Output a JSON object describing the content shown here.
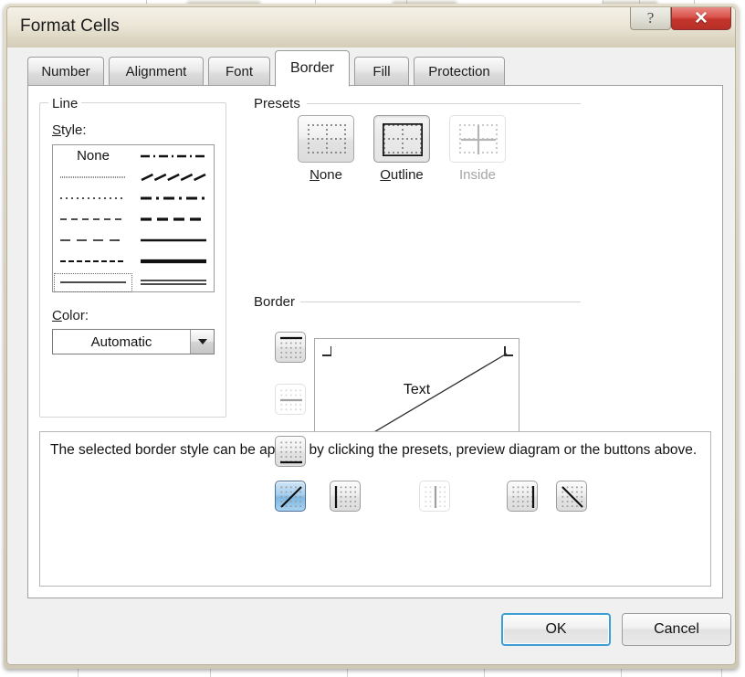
{
  "window": {
    "title": "Format Cells",
    "help_button": "?",
    "close_button": "✕"
  },
  "tabs": [
    {
      "label": "Number",
      "active": false
    },
    {
      "label": "Alignment",
      "active": false
    },
    {
      "label": "Font",
      "active": false
    },
    {
      "label": "Border",
      "active": true
    },
    {
      "label": "Fill",
      "active": false
    },
    {
      "label": "Protection",
      "active": false
    }
  ],
  "line_group": {
    "legend": "Line",
    "style_label": "Style:",
    "none_label": "None",
    "styles_left": [
      {
        "name": "none",
        "pattern": "none"
      },
      {
        "name": "hairline-dotted",
        "pattern": "fine-dotted"
      },
      {
        "name": "dotted",
        "pattern": "dotted"
      },
      {
        "name": "dashed-medium",
        "pattern": "dashed-medium"
      },
      {
        "name": "dash-long",
        "pattern": "dash-long"
      },
      {
        "name": "dashed-small",
        "pattern": "dashed-small"
      },
      {
        "name": "thin-solid",
        "pattern": "thin-solid",
        "selected": true
      }
    ],
    "styles_right": [
      {
        "name": "dash-dot",
        "pattern": "dash-dot"
      },
      {
        "name": "slanted-dash",
        "pattern": "slant-dash"
      },
      {
        "name": "dash-dot-heavy",
        "pattern": "dash-dot-heavy"
      },
      {
        "name": "dashed-heavy",
        "pattern": "dashed-heavy"
      },
      {
        "name": "solid-medium",
        "pattern": "solid-medium"
      },
      {
        "name": "solid-thick",
        "pattern": "solid-thick"
      },
      {
        "name": "double",
        "pattern": "double"
      }
    ],
    "color_label": "Color:",
    "color_value": "Automatic"
  },
  "presets": {
    "legend": "Presets",
    "items": [
      {
        "label": "None",
        "accel": "N",
        "state": "normal",
        "icon": "preset-none-icon"
      },
      {
        "label": "Outline",
        "accel": "O",
        "state": "pressed",
        "icon": "preset-outline-icon"
      },
      {
        "label": "Inside",
        "accel": "",
        "state": "disabled",
        "icon": "preset-inside-icon"
      }
    ]
  },
  "border": {
    "legend": "Border",
    "preview_text": "Text",
    "left_buttons": [
      {
        "name": "border-top-button",
        "state": "normal"
      },
      {
        "name": "border-horizontal-button",
        "state": "disabled"
      },
      {
        "name": "border-bottom-button",
        "state": "normal"
      }
    ],
    "bottom_buttons": [
      {
        "name": "border-diagonal-up-button",
        "state": "selected"
      },
      {
        "name": "border-left-button",
        "state": "normal"
      },
      {
        "name": "border-vertical-button",
        "state": "disabled"
      },
      {
        "name": "border-right-button",
        "state": "normal"
      },
      {
        "name": "border-diagonal-down-button",
        "state": "normal"
      }
    ],
    "highlight_color": "#e60000"
  },
  "description": "The selected border style can be applied by clicking the presets, preview diagram or the buttons above.",
  "footer": {
    "ok_label": "OK",
    "cancel_label": "Cancel",
    "focus_color": "#3c9fd6"
  }
}
